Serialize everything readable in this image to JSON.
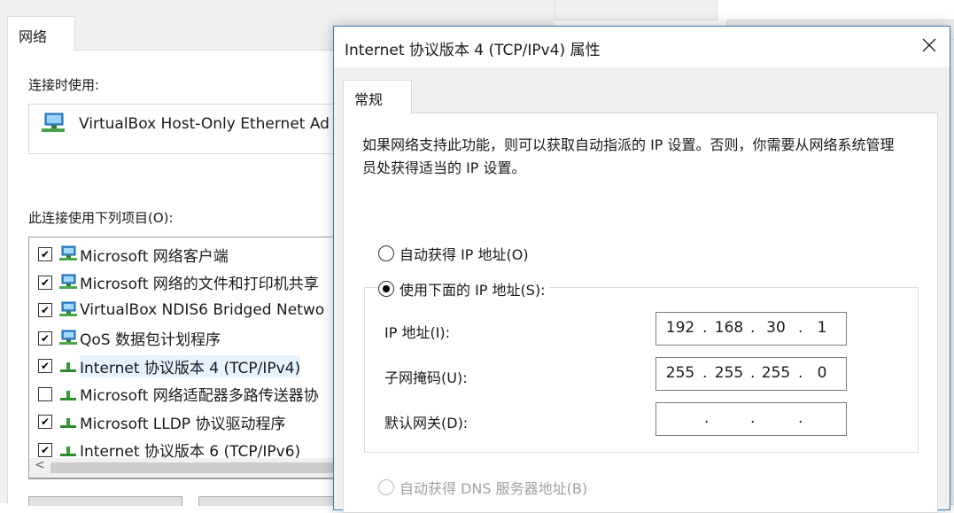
{
  "bg_dialog": {
    "tab": "网络",
    "connect_using_label": "连接时使用:",
    "adapter_name": "VirtualBox Host-Only Ethernet Ad",
    "items_label": "此连接使用下列项目(O):",
    "items": [
      {
        "label": "Microsoft 网络客户端",
        "checked": true,
        "icon": "network-client-icon"
      },
      {
        "label": "Microsoft 网络的文件和打印机共享",
        "checked": true,
        "icon": "network-client-icon"
      },
      {
        "label": "VirtualBox NDIS6 Bridged Netwo",
        "checked": true,
        "icon": "network-client-icon"
      },
      {
        "label": "QoS 数据包计划程序",
        "checked": true,
        "icon": "network-client-icon"
      },
      {
        "label": "Internet 协议版本 4 (TCP/IPv4)",
        "checked": true,
        "icon": "protocol-icon",
        "selected": true
      },
      {
        "label": "Microsoft 网络适配器多路传送器协",
        "checked": false,
        "icon": "protocol-icon"
      },
      {
        "label": "Microsoft LLDP 协议驱动程序",
        "checked": true,
        "icon": "protocol-icon"
      },
      {
        "label": "Internet 协议版本 6 (TCP/IPv6)",
        "checked": true,
        "icon": "protocol-icon"
      }
    ]
  },
  "dialog": {
    "title": "Internet 协议版本 4 (TCP/IPv4) 属性",
    "tab_general": "常规",
    "description": "如果网络支持此功能，则可以获取自动指派的 IP 设置。否则，你需要从网络系统管理员处获得适当的 IP 设置。",
    "radio_auto_ip": "自动获得 IP 地址(O)",
    "radio_manual_ip": "使用下面的 IP 地址(S):",
    "ip_label": "IP 地址(I):",
    "subnet_label": "子网掩码(U):",
    "gateway_label": "默认网关(D):",
    "ip_address": [
      "192",
      "168",
      "30",
      "1"
    ],
    "subnet_mask": [
      "255",
      "255",
      "255",
      "0"
    ],
    "gateway": [
      "",
      "",
      "",
      ""
    ],
    "radio_auto_dns": "自动获得 DNS 服务器地址(B)",
    "selected_ip_mode": "manual"
  },
  "colors": {
    "dialog_border": "#3c7fb1",
    "selection": "#e5f3ff"
  }
}
